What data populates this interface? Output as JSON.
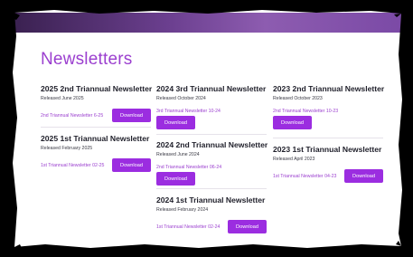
{
  "page": {
    "title": "Newsletters"
  },
  "download_label": "Download",
  "newsletters": [
    {
      "name": "2025 2nd Triannual Newsletter",
      "released": "Released June 2025",
      "file": "2nd Triannual Newsletter 6-25"
    },
    {
      "name": "2025 1st Triannual Newsletter",
      "released": "Released February 2025",
      "file": "1st Triannual Newsletter 02-25"
    },
    {
      "name": "2024 3rd Triannual Newsletter",
      "released": "Released October 2024",
      "file": "3rd Triannual Newsletter 10-24"
    },
    {
      "name": "2024 2nd Triannual Newsletter",
      "released": "Released June 2024",
      "file": "2nd Triannual Newsletter 06-24"
    },
    {
      "name": "2024 1st Triannual Newsletter",
      "released": "Released February 2024",
      "file": "1st Triannual Newsletter 02-24"
    },
    {
      "name": "2023 2nd Triannual Newsletter",
      "released": "Released October 2023",
      "file": "2nd Triannual Newsletter 10-23"
    },
    {
      "name": "2023 1st Triannual Newsletter",
      "released": "Released April 2023",
      "file": "1st Triannual Newsletter 04-23"
    }
  ]
}
